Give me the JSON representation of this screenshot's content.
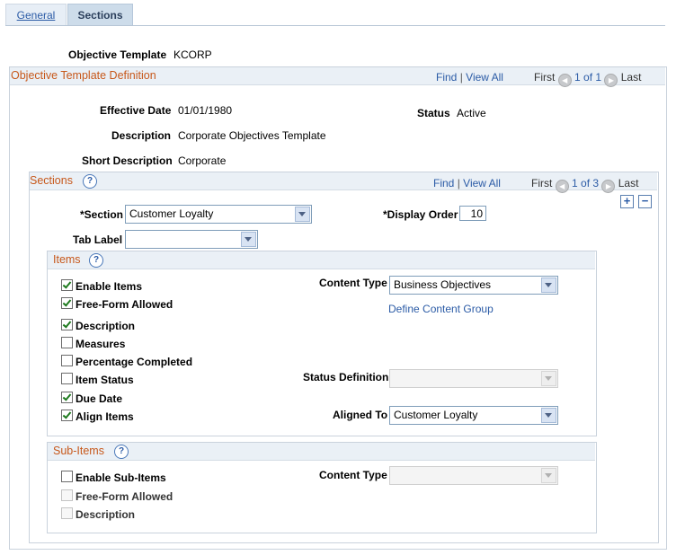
{
  "tabs": [
    {
      "label": "General"
    },
    {
      "label": "Sections"
    }
  ],
  "header": {
    "objective_template_label": "Objective Template",
    "objective_template_value": "KCORP"
  },
  "definition": {
    "title": "Objective Template Definition",
    "nav": {
      "find": "Find",
      "sep": "|",
      "view_all": "View All",
      "first": "First",
      "count": "1 of 1",
      "last": "Last"
    },
    "effective_date_label": "Effective Date",
    "effective_date_value": "01/01/1980",
    "status_label": "Status",
    "status_value": "Active",
    "description_label": "Description",
    "description_value": "Corporate Objectives Template",
    "short_description_label": "Short Description",
    "short_description_value": "Corporate"
  },
  "sections": {
    "title": "Sections",
    "nav": {
      "find": "Find",
      "sep": "|",
      "view_all": "View All",
      "first": "First",
      "count": "1 of 3",
      "last": "Last"
    },
    "section_label": "*Section",
    "section_value": "Customer Loyalty",
    "display_order_label": "*Display Order",
    "display_order_value": "10",
    "tab_label_label": "Tab Label",
    "tab_label_value": ""
  },
  "items": {
    "title": "Items",
    "enable_items": "Enable Items",
    "free_form_allowed": "Free-Form Allowed",
    "description": "Description",
    "measures": "Measures",
    "percentage_completed": "Percentage Completed",
    "item_status": "Item Status",
    "due_date": "Due Date",
    "align_items": "Align Items",
    "content_type_label": "Content Type",
    "content_type_value": "Business Objectives",
    "define_content_group": "Define Content Group",
    "status_definition_label": "Status Definition",
    "status_definition_value": "",
    "aligned_to_label": "Aligned To",
    "aligned_to_value": "Customer Loyalty"
  },
  "subitems": {
    "title": "Sub-Items",
    "enable_subitems": "Enable Sub-Items",
    "free_form_allowed": "Free-Form Allowed",
    "description": "Description",
    "content_type_label": "Content Type",
    "content_type_value": ""
  },
  "icons": {
    "help": "?",
    "add": "+",
    "remove": "−",
    "prev": "◀",
    "next": "▶"
  },
  "colors": {
    "accent_title": "#c7581b",
    "link": "#2b5ba6",
    "bar_bg": "#eaf0f6"
  }
}
